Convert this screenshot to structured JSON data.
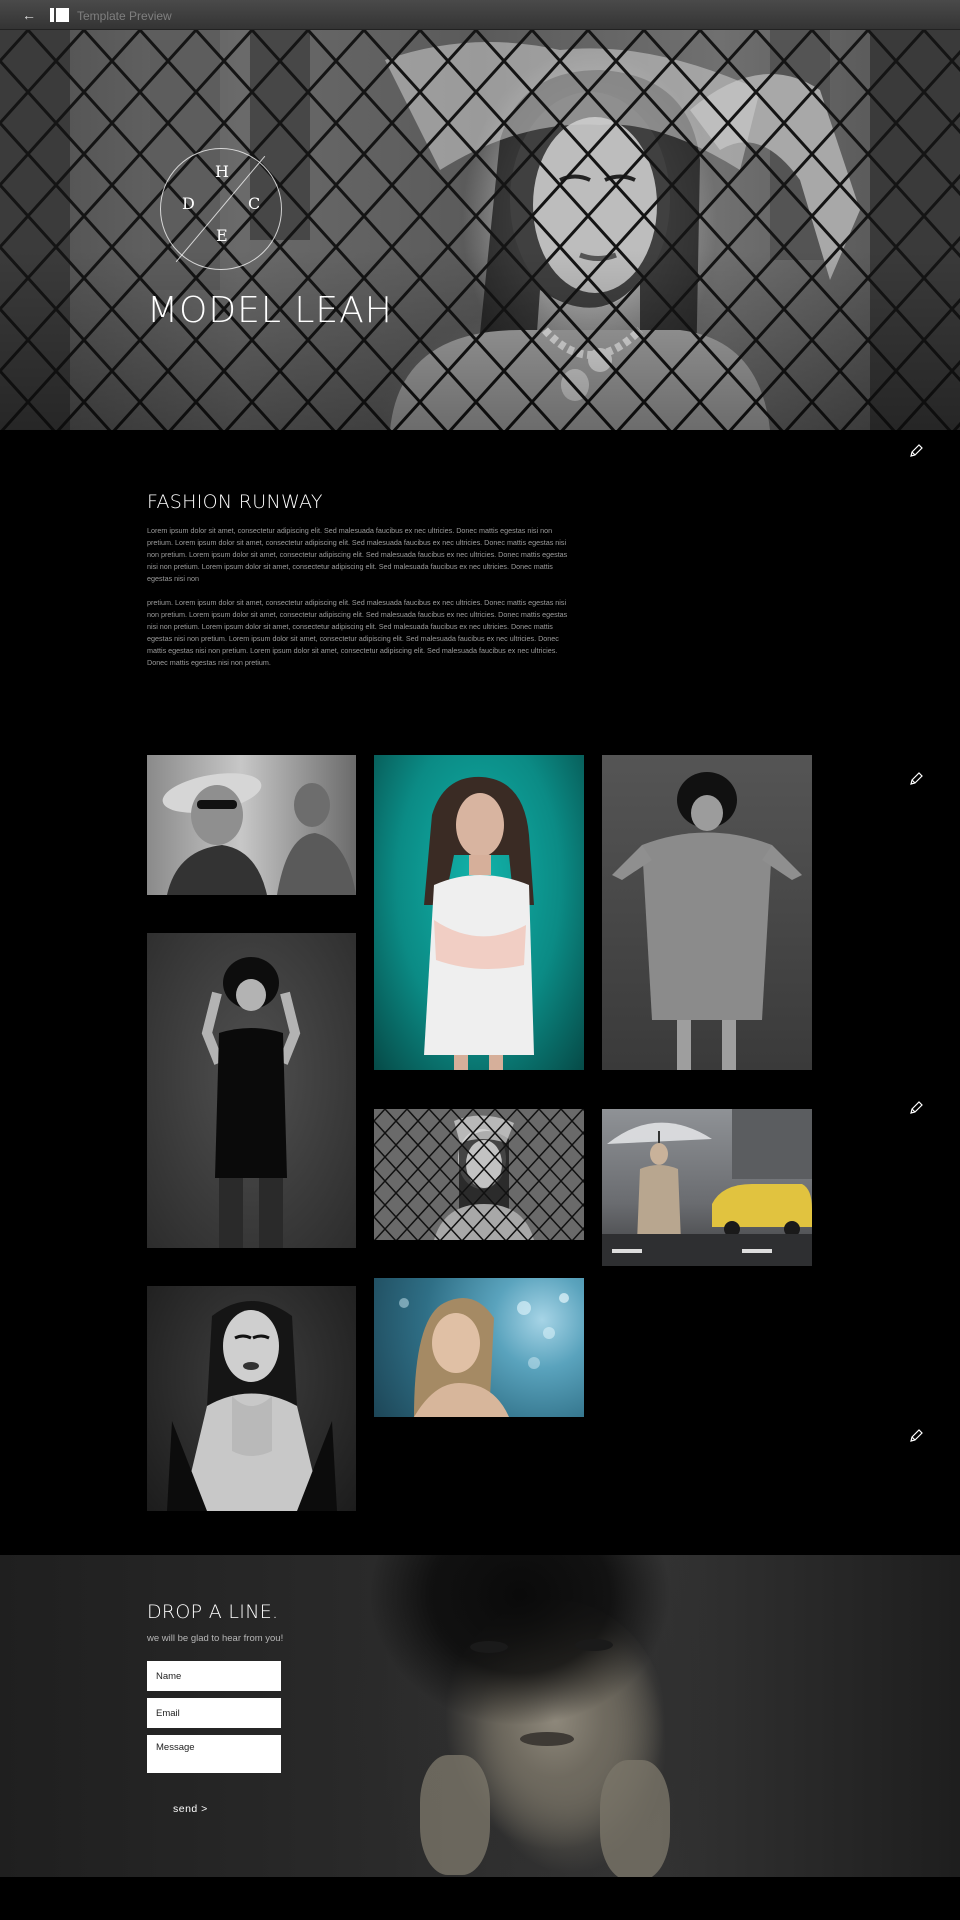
{
  "topbar": {
    "back_glyph": "←",
    "title": "Template Preview"
  },
  "hero": {
    "monogram": {
      "top": "H",
      "left": "D",
      "right": "C",
      "bottom": "E"
    },
    "name": "MODEL LEAH"
  },
  "about": {
    "title": "FASHION RUNWAY",
    "paragraph_1": "Lorem ipsum dolor sit amet, consectetur adipiscing elit. Sed malesuada faucibus ex nec ultricies. Donec mattis egestas nisi non pretium. Lorem ipsum dolor sit amet, consectetur adipiscing elit. Sed malesuada faucibus ex nec ultricies. Donec mattis egestas nisi non pretium. Lorem ipsum dolor sit amet, consectetur adipiscing elit. Sed malesuada faucibus ex nec ultricies. Donec mattis egestas nisi non pretium. Lorem ipsum dolor sit amet, consectetur adipiscing elit. Sed malesuada faucibus ex nec ultricies. Donec mattis egestas nisi non",
    "paragraph_2": "pretium. Lorem ipsum dolor sit amet, consectetur adipiscing elit. Sed malesuada faucibus ex nec ultricies. Donec mattis egestas nisi non pretium. Lorem ipsum dolor sit amet, consectetur adipiscing elit. Sed malesuada faucibus ex nec ultricies. Donec mattis egestas nisi non pretium. Lorem ipsum dolor sit amet, consectetur adipiscing elit. Sed malesuada faucibus ex nec ultricies. Donec mattis egestas nisi non pretium. Lorem ipsum dolor sit amet, consectetur adipiscing elit. Sed malesuada faucibus ex nec ultricies. Donec mattis egestas nisi non pretium. Lorem ipsum dolor sit amet, consectetur adipiscing elit. Sed malesuada faucibus ex nec ultricies. Donec mattis egestas nisi non pretium."
  },
  "contact": {
    "title": "DROP A LINE.",
    "subtitle": "we will be glad to hear from you!",
    "name_placeholder": "Name",
    "email_placeholder": "Email",
    "message_placeholder": "Message",
    "send_label": "send >"
  },
  "icons": {
    "edit": "pencil-icon",
    "back": "back-arrow-icon"
  },
  "colors": {
    "page_background": "#000000",
    "topbar": "#3a3a3a",
    "body_text": "#9c9c9c",
    "gallery_teal": "#0f9a94",
    "gallery_blue": "#3b8fa8"
  }
}
